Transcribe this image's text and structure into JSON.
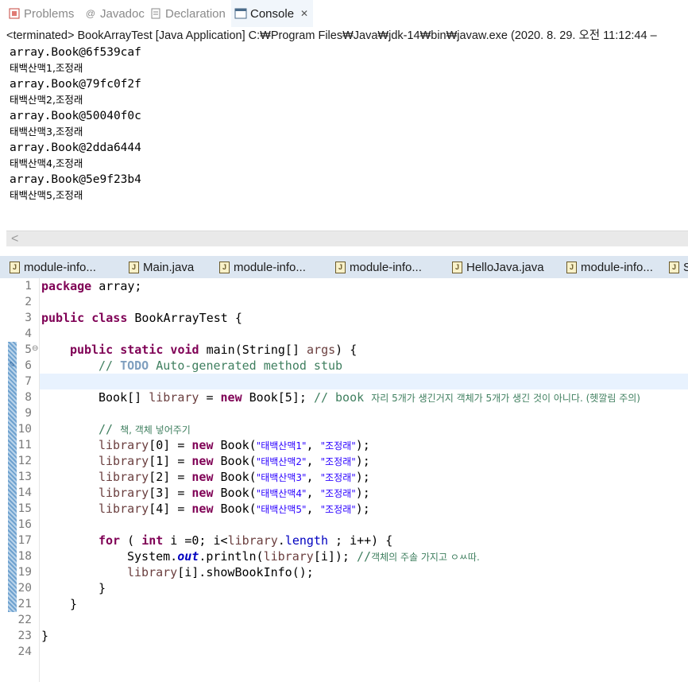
{
  "view_tabs": [
    {
      "label": "Problems",
      "icon": "problems-icon"
    },
    {
      "label": "Javadoc",
      "icon": "javadoc-icon"
    },
    {
      "label": "Declaration",
      "icon": "declaration-icon"
    },
    {
      "label": "Console",
      "icon": "console-icon",
      "active": true
    }
  ],
  "console": {
    "status": "<terminated> BookArrayTest [Java Application] C:₩Program Files₩Java₩jdk-14₩bin₩javaw.exe  (2020. 8. 29. 오전 11:12:44 – ",
    "lines": [
      "array.Book@6f539caf",
      "태백산맥1,조정래",
      "array.Book@79fc0f2f",
      "태백산맥2,조정래",
      "array.Book@50040f0c",
      "태백산맥3,조정래",
      "array.Book@2dda6444",
      "태백산맥4,조정래",
      "array.Book@5e9f23b4",
      "태백산맥5,조정래"
    ],
    "scroll_left_glyph": "<"
  },
  "editor_tabs": [
    "module-info...",
    "Main.java",
    "module-info...",
    "module-info...",
    "HelloJava.java",
    "module-info...",
    "S"
  ],
  "editor": {
    "line_numbers": [
      "1",
      "2",
      "3",
      "4",
      "5",
      "6",
      "7",
      "8",
      "9",
      "10",
      "11",
      "12",
      "13",
      "14",
      "15",
      "16",
      "17",
      "18",
      "19",
      "20",
      "21",
      "22",
      "23",
      "24"
    ],
    "code": {
      "l1_kw": "package",
      "l1_rest": " array;",
      "l3_kw": "public class",
      "l3_rest": " BookArrayTest {",
      "l5_kw": "public static void",
      "l5_rest": " main(String[] ",
      "l5_var": "args",
      "l5_end": ") {",
      "l6_cm": "// ",
      "l6_todo": "TODO",
      "l6_rest": " Auto-generated method stub",
      "l8_a": "Book[] ",
      "l8_var": "library",
      "l8_b": " = ",
      "l8_kw": "new",
      "l8_c": " Book[5]; ",
      "l8_cm": "// book ",
      "l8_ko": "자리 5개가 생긴거지 객체가 5개가 생긴 것이 아니다. (헷깔림 주의)",
      "l10_cm": "// ",
      "l10_ko": "책, 객체 넣어주기",
      "lib_rows": [
        {
          "var": "library",
          "idx": "[0] = ",
          "kw": "new",
          "call": " Book(",
          "s1": "\"태백산맥1\"",
          "sep": ", ",
          "s2": "\"조정래\"",
          "end": ");"
        },
        {
          "var": "library",
          "idx": "[1] = ",
          "kw": "new",
          "call": " Book(",
          "s1": "\"태백산맥2\"",
          "sep": ", ",
          "s2": "\"조정래\"",
          "end": ");"
        },
        {
          "var": "library",
          "idx": "[2] = ",
          "kw": "new",
          "call": " Book(",
          "s1": "\"태백산맥3\"",
          "sep": ", ",
          "s2": "\"조정래\"",
          "end": ");"
        },
        {
          "var": "library",
          "idx": "[3] = ",
          "kw": "new",
          "call": " Book(",
          "s1": "\"태백산맥4\"",
          "sep": ", ",
          "s2": "\"조정래\"",
          "end": ");"
        },
        {
          "var": "library",
          "idx": "[4] = ",
          "kw": "new",
          "call": " Book(",
          "s1": "\"태백산맥5\"",
          "sep": ", ",
          "s2": "\"조정래\"",
          "end": ");"
        }
      ],
      "l17_kw1": "for",
      "l17_a": " ( ",
      "l17_kw2": "int",
      "l17_b": " i =0; i<",
      "l17_var": "library",
      "l17_c": ".",
      "l17_fld": "length",
      "l17_d": " ; i++) {",
      "l18_a": "System.",
      "l18_sfld": "out",
      "l18_b": ".println(",
      "l18_var": "library",
      "l18_c": "[i]); ",
      "l18_cm": "//",
      "l18_ko": "객체의 주솔 가지고 ㅇㅆ따.",
      "l19_var": "library",
      "l19_rest": "[i].showBookInfo();",
      "l20": "}",
      "l21": "}",
      "l23": "}"
    }
  },
  "colors": {
    "keyword": "#7f0055",
    "comment": "#3f7f5f",
    "string": "#2a00ff",
    "field": "#0000c0",
    "local_var": "#6a3e3e",
    "editor_tab_bar": "#dce6f1",
    "current_line": "#e8f2fe"
  }
}
